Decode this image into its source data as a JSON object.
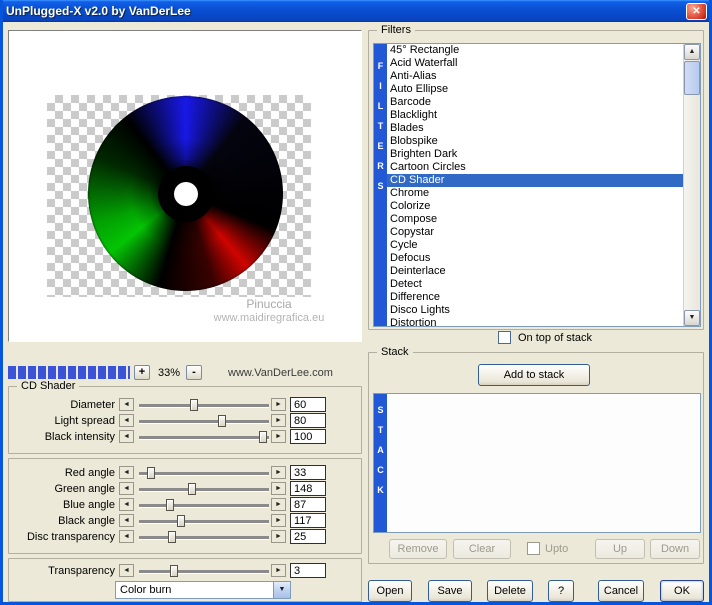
{
  "window": {
    "title": "UnPlugged-X v2.0 by VanDerLee"
  },
  "icons": {
    "close": "✕",
    "combo_arrow": "▼",
    "scroll_up": "▲",
    "scroll_down": "▼",
    "slider_left": "◄",
    "slider_right": "►"
  },
  "preview": {
    "watermark_line1": "Pinuccia",
    "watermark_line2": "www.maidiregrafica.eu"
  },
  "zoombar": {
    "plus_label": "+",
    "zoom_level": "33%",
    "minus_label": "-",
    "website": "www.VanDerLee.com"
  },
  "controls": {
    "group_title": "CD Shader",
    "groups": [
      {
        "sliders": [
          {
            "label": "Diameter",
            "value": "60",
            "pos": 42
          },
          {
            "label": "Light spread",
            "value": "80",
            "pos": 64
          },
          {
            "label": "Black intensity",
            "value": "100",
            "pos": 95
          }
        ]
      },
      {
        "sliders": [
          {
            "label": "Red angle",
            "value": "33",
            "pos": 9
          },
          {
            "label": "Green angle",
            "value": "148",
            "pos": 41
          },
          {
            "label": "Blue angle",
            "value": "87",
            "pos": 24
          },
          {
            "label": "Black angle",
            "value": "117",
            "pos": 32
          },
          {
            "label": "Disc transparency",
            "value": "25",
            "pos": 25
          }
        ]
      },
      {
        "sliders": [
          {
            "label": "Transparency",
            "value": "3",
            "pos": 27
          }
        ]
      }
    ],
    "blend_mode": "Color burn"
  },
  "filters": {
    "group_title": "Filters",
    "vertical_label": "FILTERS",
    "selected": "CD Shader",
    "items": [
      "45° Rectangle",
      "Acid Waterfall",
      "Anti-Alias",
      "Auto Ellipse",
      "Barcode",
      "Blacklight",
      "Blades",
      "Blobspike",
      "Brighten Dark",
      "Cartoon Circles",
      "CD Shader",
      "Chrome",
      "Colorize",
      "Compose",
      "Copystar",
      "Cycle",
      "Defocus",
      "Deinterlace",
      "Detect",
      "Difference",
      "Disco Lights",
      "Distortion"
    ],
    "on_top_label": "On top of stack"
  },
  "stack": {
    "group_title": "Stack",
    "add_button": "Add to stack",
    "vertical_label": "STACK",
    "remove_button": "Remove",
    "clear_button": "Clear",
    "upto_label": "Upto",
    "up_button": "Up",
    "down_button": "Down"
  },
  "footer": {
    "open": "Open",
    "save": "Save",
    "delete": "Delete",
    "help": "?",
    "cancel": "Cancel",
    "ok": "OK"
  },
  "colors": {
    "titlebar_blue": "#0a52d6",
    "highlight_blue": "#316ac5",
    "strip_blue": "#2257d6",
    "window_frame": "#0855dd"
  }
}
